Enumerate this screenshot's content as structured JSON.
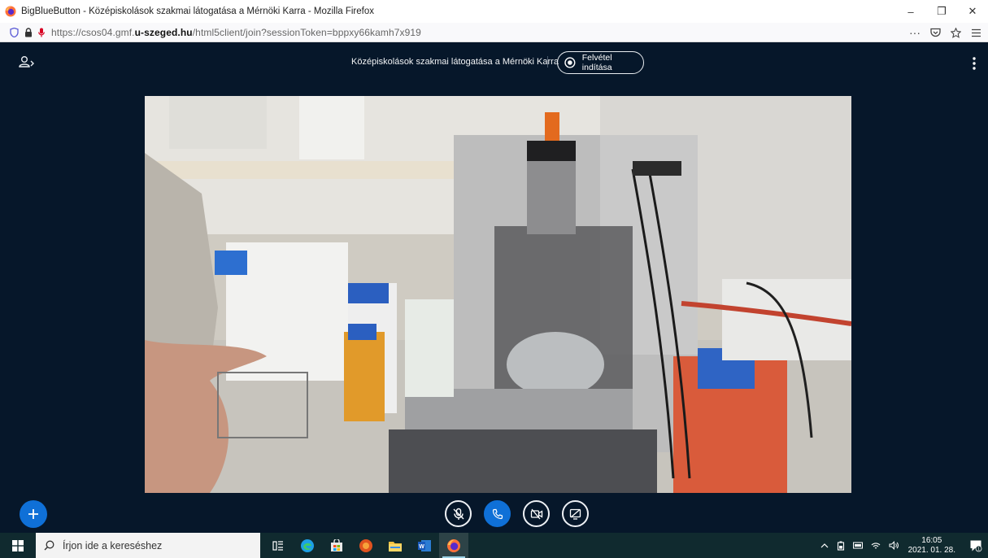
{
  "browser": {
    "window_title": "BigBlueButton - Középiskolások szakmai látogatása a Mérnöki Karra - Mozilla Firefox",
    "url_prefix": "https://csos04.gmf.",
    "url_domain": "u-szeged.hu",
    "url_suffix": "/html5client/join?sessionToken=bppxy66kamh7x919",
    "toolbar_more": "···",
    "window_controls": {
      "minimize": "–",
      "restore": "❐",
      "close": "✕"
    }
  },
  "meeting": {
    "title": "Középiskolások szakmai látogatása a Mérnöki Karra",
    "record_label": "Felvétel indítása"
  },
  "colors": {
    "app_bg": "#06172a",
    "accent": "#0f70d7",
    "taskbar": "#102a2f"
  },
  "taskbar": {
    "search_placeholder": "Írjon ide a kereséshez",
    "apps": [
      "task-view-icon",
      "edge-icon",
      "store-icon",
      "media-icon",
      "file-explorer-icon",
      "word-icon",
      "firefox-icon"
    ],
    "time": "16:05",
    "date": "2021. 01. 28.",
    "notification_count": "1"
  }
}
